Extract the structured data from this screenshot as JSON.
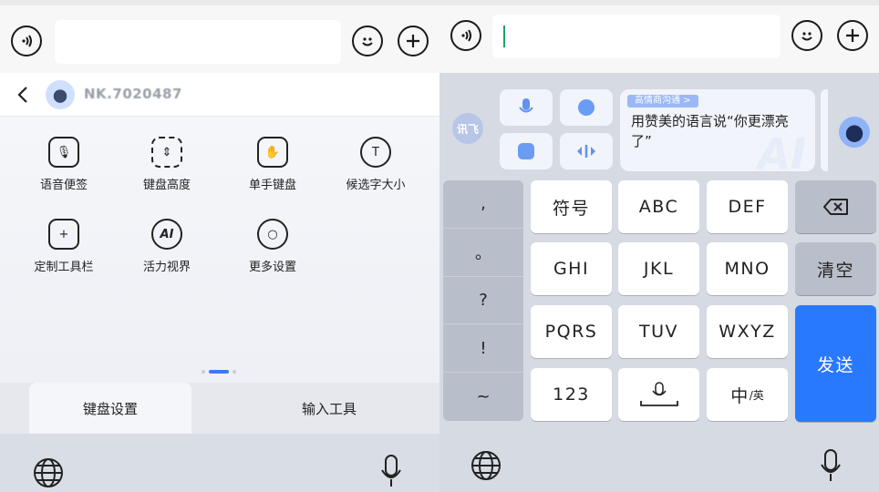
{
  "left": {
    "brand": {
      "name": "NK.7020487"
    },
    "tools": [
      {
        "label": "语音便签",
        "icon": "voice-note-icon",
        "glyph": "🎙"
      },
      {
        "label": "键盘高度",
        "icon": "keyboard-height-icon",
        "glyph": "⇕"
      },
      {
        "label": "单手键盘",
        "icon": "one-hand-keyboard-icon",
        "glyph": "✋"
      },
      {
        "label": "候选字大小",
        "icon": "candidate-size-icon",
        "glyph": "T"
      },
      {
        "label": "定制工具栏",
        "icon": "custom-toolbar-icon",
        "glyph": "+"
      },
      {
        "label": "活力视界",
        "icon": "ai-vision-icon",
        "glyph": "AI"
      },
      {
        "label": "更多设置",
        "icon": "more-settings-icon",
        "glyph": "○"
      }
    ],
    "tabs": {
      "settings": "键盘设置",
      "input_tools": "输入工具"
    }
  },
  "right": {
    "xunfei_logo": "讯飞",
    "ai_card": {
      "badge": "高情商沟通 >",
      "text": "用赞美的语言说“你更漂亮了”",
      "watermark": "AI"
    },
    "symbols": [
      ",",
      "。",
      "?",
      "!",
      "~"
    ],
    "keys": {
      "fuhao": "符号",
      "abc": "ABC",
      "def": "DEF",
      "ghi": "GHI",
      "jkl": "JKL",
      "mno": "MNO",
      "clear": "清空",
      "pqrs": "PQRS",
      "tuv": "TUV",
      "wxyz": "WXYZ",
      "send": "发送",
      "num": "123",
      "lang_main": "中",
      "lang_sub": "/英"
    }
  },
  "colors": {
    "accent": "#2979ff",
    "cursor": "#19a36b"
  }
}
